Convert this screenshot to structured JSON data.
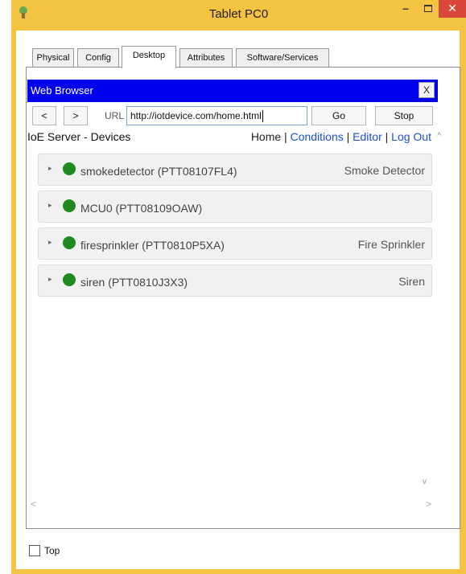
{
  "window": {
    "title": "Tablet PC0"
  },
  "tabs": [
    {
      "label": "Physical",
      "active": false
    },
    {
      "label": "Config",
      "active": false
    },
    {
      "label": "Desktop",
      "active": true
    },
    {
      "label": "Attributes",
      "active": false
    },
    {
      "label": "Software/Services",
      "active": false
    }
  ],
  "browser": {
    "title": "Web Browser",
    "close_label": "X",
    "back_label": "<",
    "forward_label": ">",
    "url_label": "URL",
    "url_value": "http://iotdevice.com/home.html",
    "go_label": "Go",
    "stop_label": "Stop"
  },
  "page": {
    "title": "IoE Server - Devices",
    "links": {
      "home": "Home",
      "sep1": " | ",
      "conditions": "Conditions",
      "sep2": " | ",
      "editor": "Editor",
      "sep3": " | ",
      "logout": "Log Out"
    }
  },
  "devices": [
    {
      "name": "smokedetector (PTT08107FL4)",
      "type": "Smoke Detector",
      "status_color": "#1f8a1f"
    },
    {
      "name": "MCU0 (PTT08109OAW)",
      "type": "",
      "status_color": "#1f8a1f"
    },
    {
      "name": "firesprinkler (PTT0810P5XA)",
      "type": "Fire Sprinkler",
      "status_color": "#1f8a1f"
    },
    {
      "name": "siren (PTT0810J3X3)",
      "type": "Siren",
      "status_color": "#1f8a1f"
    }
  ],
  "footer": {
    "top_checkbox_label": "Top",
    "top_checked": false
  },
  "colors": {
    "titlebar": "#f5c342",
    "browser_header": "#0000ee",
    "close_button": "#d9473b",
    "link": "#1a4fd0"
  }
}
